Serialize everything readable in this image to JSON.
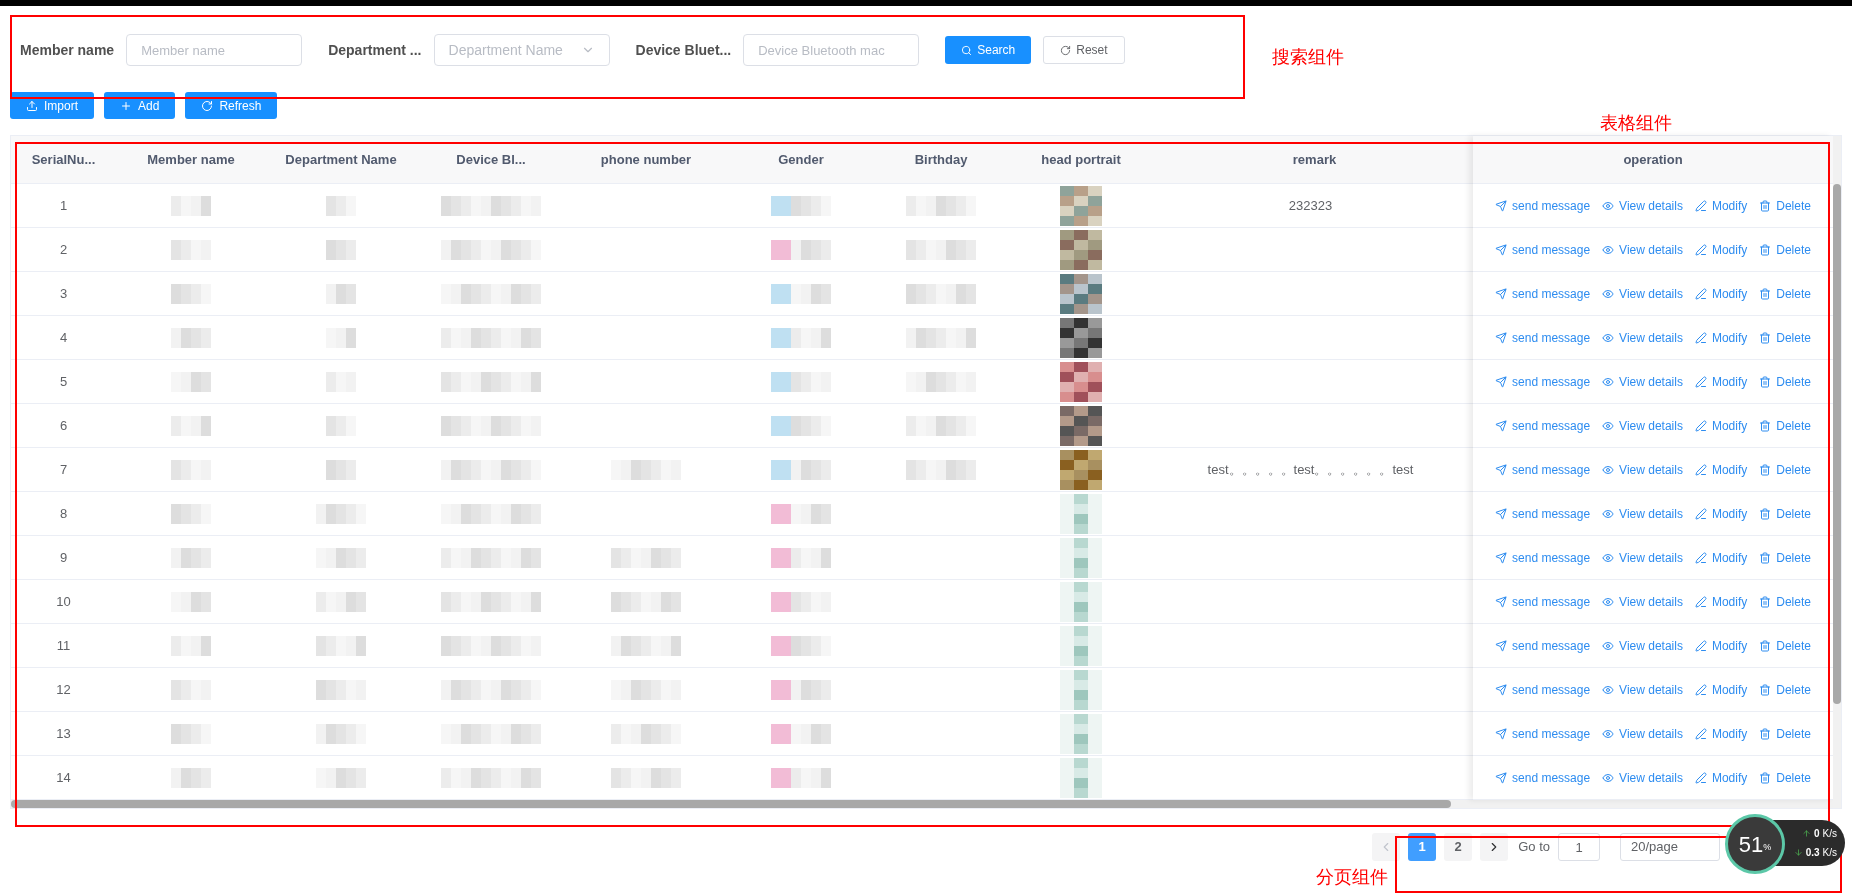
{
  "search": {
    "fields": [
      {
        "kind": "input",
        "label": "Member name",
        "placeholder": "Member name"
      },
      {
        "kind": "select",
        "label": "Department ...",
        "placeholder": "Department Name"
      },
      {
        "kind": "input",
        "label": "Device Bluet...",
        "placeholder": "Device Bluetooth mac"
      }
    ],
    "buttons": [
      {
        "kind": "primary",
        "label": "Search"
      },
      {
        "kind": "default",
        "label": "Reset"
      }
    ]
  },
  "toolbar": [
    {
      "kind": "upload",
      "label": "Import"
    },
    {
      "kind": "add",
      "label": "Add"
    },
    {
      "kind": "refresh",
      "label": "Refresh"
    }
  ],
  "table": {
    "columns": [
      "SerialNu...",
      "Member name",
      "Department Name",
      "Device Bl...",
      "phone number",
      "Gender",
      "Birthday",
      "head portrait",
      "remark",
      "operation"
    ],
    "rows": [
      {
        "serial": "1",
        "phone_masked": false,
        "birthday_masked": true,
        "remark": "232323",
        "actions": [
          {
            "kind": "send",
            "label": "send message"
          },
          {
            "kind": "view",
            "label": "View details"
          },
          {
            "kind": "modify",
            "label": "Modify"
          },
          {
            "kind": "delete",
            "label": "Delete"
          }
        ]
      },
      {
        "serial": "2",
        "phone_masked": false,
        "birthday_masked": true,
        "actions": [
          {
            "kind": "send",
            "label": "send message"
          },
          {
            "kind": "view",
            "label": "View details"
          },
          {
            "kind": "modify",
            "label": "Modify"
          },
          {
            "kind": "delete",
            "label": "Delete"
          }
        ]
      },
      {
        "serial": "3",
        "phone_masked": false,
        "birthday_masked": true,
        "actions": [
          {
            "kind": "send",
            "label": "send message"
          },
          {
            "kind": "view",
            "label": "View details"
          },
          {
            "kind": "modify",
            "label": "Modify"
          },
          {
            "kind": "delete",
            "label": "Delete"
          }
        ]
      },
      {
        "serial": "4",
        "phone_masked": false,
        "birthday_masked": true,
        "actions": [
          {
            "kind": "send",
            "label": "send message"
          },
          {
            "kind": "view",
            "label": "View details"
          },
          {
            "kind": "modify",
            "label": "Modify"
          },
          {
            "kind": "delete",
            "label": "Delete"
          }
        ]
      },
      {
        "serial": "5",
        "phone_masked": false,
        "birthday_masked": true,
        "actions": [
          {
            "kind": "send",
            "label": "send message"
          },
          {
            "kind": "view",
            "label": "View details"
          },
          {
            "kind": "modify",
            "label": "Modify"
          },
          {
            "kind": "delete",
            "label": "Delete"
          }
        ]
      },
      {
        "serial": "6",
        "phone_masked": false,
        "birthday_masked": true,
        "actions": [
          {
            "kind": "send",
            "label": "send message"
          },
          {
            "kind": "view",
            "label": "View details"
          },
          {
            "kind": "modify",
            "label": "Modify"
          },
          {
            "kind": "delete",
            "label": "Delete"
          }
        ]
      },
      {
        "serial": "7",
        "phone_masked": true,
        "birthday_masked": true,
        "remark": "test。。。。。test。。。。。。test",
        "actions": [
          {
            "kind": "send",
            "label": "send message"
          },
          {
            "kind": "view",
            "label": "View details"
          },
          {
            "kind": "modify",
            "label": "Modify"
          },
          {
            "kind": "delete",
            "label": "Delete"
          }
        ]
      },
      {
        "serial": "8",
        "phone_masked": false,
        "birthday_masked": false,
        "actions": [
          {
            "kind": "send",
            "label": "send message"
          },
          {
            "kind": "view",
            "label": "View details"
          },
          {
            "kind": "modify",
            "label": "Modify"
          },
          {
            "kind": "delete",
            "label": "Delete"
          }
        ]
      },
      {
        "serial": "9",
        "phone_masked": true,
        "birthday_masked": false,
        "actions": [
          {
            "kind": "send",
            "label": "send message"
          },
          {
            "kind": "view",
            "label": "View details"
          },
          {
            "kind": "modify",
            "label": "Modify"
          },
          {
            "kind": "delete",
            "label": "Delete"
          }
        ]
      },
      {
        "serial": "10",
        "phone_masked": true,
        "birthday_masked": false,
        "actions": [
          {
            "kind": "send",
            "label": "send message"
          },
          {
            "kind": "view",
            "label": "View details"
          },
          {
            "kind": "modify",
            "label": "Modify"
          },
          {
            "kind": "delete",
            "label": "Delete"
          }
        ]
      },
      {
        "serial": "11",
        "phone_masked": true,
        "birthday_masked": false,
        "actions": [
          {
            "kind": "send",
            "label": "send message"
          },
          {
            "kind": "view",
            "label": "View details"
          },
          {
            "kind": "modify",
            "label": "Modify"
          },
          {
            "kind": "delete",
            "label": "Delete"
          }
        ]
      },
      {
        "serial": "12",
        "phone_masked": true,
        "birthday_masked": false,
        "actions": [
          {
            "kind": "send",
            "label": "send message"
          },
          {
            "kind": "view",
            "label": "View details"
          },
          {
            "kind": "modify",
            "label": "Modify"
          },
          {
            "kind": "delete",
            "label": "Delete"
          }
        ]
      },
      {
        "serial": "13",
        "phone_masked": true,
        "birthday_masked": false,
        "actions": [
          {
            "kind": "send",
            "label": "send message"
          },
          {
            "kind": "view",
            "label": "View details"
          },
          {
            "kind": "modify",
            "label": "Modify"
          },
          {
            "kind": "delete",
            "label": "Delete"
          }
        ]
      },
      {
        "serial": "14",
        "phone_masked": true,
        "birthday_masked": false,
        "actions": [
          {
            "kind": "send",
            "label": "send message"
          },
          {
            "kind": "view",
            "label": "View details"
          },
          {
            "kind": "modify",
            "label": "Modify"
          },
          {
            "kind": "delete",
            "label": "Delete"
          }
        ]
      }
    ]
  },
  "pagination": {
    "prev_disabled": true,
    "pages": [
      {
        "label": "1",
        "selected": true
      },
      {
        "label": "2",
        "selected": false
      }
    ],
    "goto_label": "Go to",
    "goto_value": "1",
    "page_size": "20/page"
  },
  "annotations": [
    {
      "kind": "search",
      "label": "搜索组件"
    },
    {
      "kind": "table",
      "label": "表格组件"
    },
    {
      "kind": "pagination",
      "label": "分页组件"
    }
  ],
  "net_widget": {
    "percent": "51",
    "percent_unit": "%",
    "upload": "0",
    "upload_unit": "K/s",
    "download": "0.3",
    "download_unit": "K/s"
  }
}
